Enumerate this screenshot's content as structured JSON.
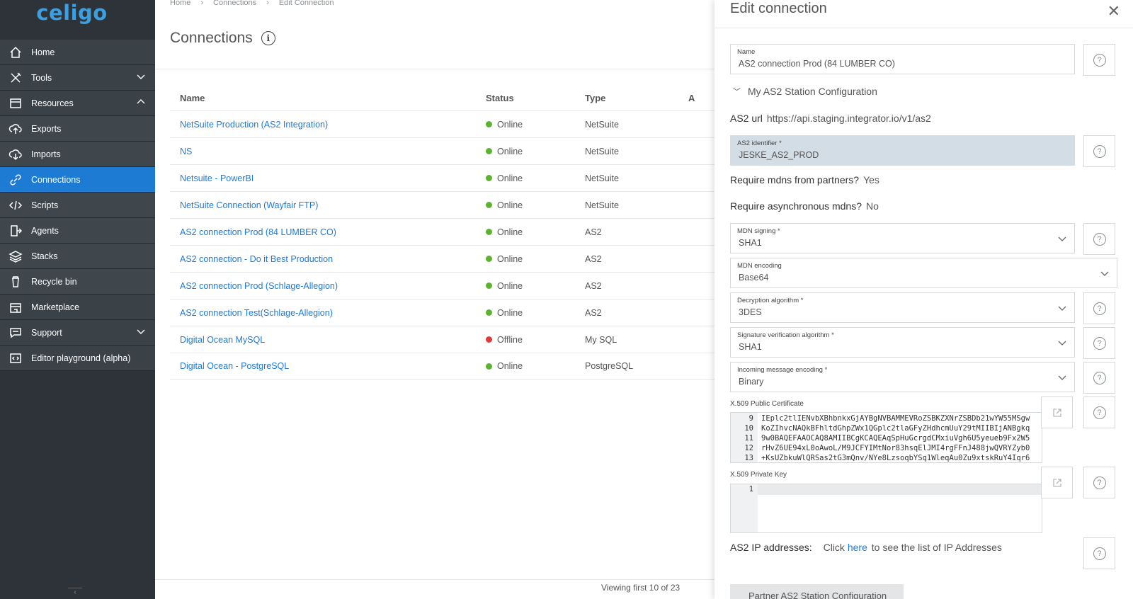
{
  "app": {
    "logo": "celigo"
  },
  "sidebar": {
    "items": [
      {
        "label": "Home",
        "icon": "home-icon"
      },
      {
        "label": "Tools",
        "icon": "tools-icon",
        "chevron": "down"
      },
      {
        "label": "Resources",
        "icon": "resources-icon",
        "chevron": "up"
      },
      {
        "label": "Exports",
        "icon": "upload-icon",
        "sub": true
      },
      {
        "label": "Imports",
        "icon": "download-icon",
        "sub": true
      },
      {
        "label": "Connections",
        "icon": "link-icon",
        "sub": true,
        "active": true
      },
      {
        "label": "Scripts",
        "icon": "code-icon",
        "sub": true
      },
      {
        "label": "Agents",
        "icon": "agent-icon",
        "sub": true
      },
      {
        "label": "Stacks",
        "icon": "stack-icon",
        "sub": true
      },
      {
        "label": "Recycle bin",
        "icon": "recycle-icon",
        "sub": true
      },
      {
        "label": "Marketplace",
        "icon": "store-icon"
      },
      {
        "label": "Support",
        "icon": "chat-icon",
        "chevron": "down"
      },
      {
        "label": "Editor playground (alpha)",
        "icon": "editor-icon"
      }
    ]
  },
  "breadcrumb": [
    "Home",
    "Connections",
    "Edit Connection"
  ],
  "page": {
    "title": "Connections"
  },
  "table": {
    "headers": [
      "Name",
      "Status",
      "Type",
      "A"
    ],
    "rows": [
      {
        "name": "NetSuite Production (AS2 Integration)",
        "status": "Online",
        "type": "NetSuite"
      },
      {
        "name": "NS",
        "status": "Online",
        "type": "NetSuite"
      },
      {
        "name": "Netsuite - PowerBI",
        "status": "Online",
        "type": "NetSuite"
      },
      {
        "name": "NetSuite Connection (Wayfair FTP)",
        "status": "Online",
        "type": "NetSuite"
      },
      {
        "name": "AS2 connection Prod (84 LUMBER CO)",
        "status": "Online",
        "type": "AS2"
      },
      {
        "name": "AS2 connection - Do it Best Production",
        "status": "Online",
        "type": "AS2"
      },
      {
        "name": "AS2 connection Prod (Schlage-Allegion)",
        "status": "Online",
        "type": "AS2"
      },
      {
        "name": "AS2 connection Test(Schlage-Allegion)",
        "status": "Online",
        "type": "AS2"
      },
      {
        "name": "Digital Ocean MySQL",
        "status": "Offline",
        "type": "My SQL"
      },
      {
        "name": "Digital Ocean - PostgreSQL",
        "status": "Online",
        "type": "PostgreSQL"
      }
    ],
    "pager": "Viewing first 10 of 23"
  },
  "colors": {
    "online": "#5cb331",
    "offline": "#e03a3a",
    "accent": "#1d7bd4",
    "sidebar": "#2d3338"
  },
  "panel": {
    "title": "Edit connection",
    "name_label": "Name",
    "name_value": "AS2 connection Prod (84 LUMBER CO)",
    "my_station_toggle": "My AS2 Station Configuration",
    "as2_url_label": "AS2 url",
    "as2_url_value": "https://api.staging.integrator.io/v1/as2",
    "as2_identifier_label": "AS2 identifier *",
    "as2_identifier_value": "JESKE_AS2_PROD",
    "require_mdns_label": "Require mdns from partners?",
    "require_mdns_value": "Yes",
    "require_async_label": "Require asynchronous mdns?",
    "require_async_value": "No",
    "mdn_signing_label": "MDN signing *",
    "mdn_signing_value": "SHA1",
    "mdn_encoding_label": "MDN encoding",
    "mdn_encoding_value": "Base64",
    "decryption_label": "Decryption algorithm *",
    "decryption_value": "3DES",
    "sig_verif_label": "Signature verification algorithm *",
    "sig_verif_value": "SHA1",
    "incoming_enc_label": "Incoming message encoding *",
    "incoming_enc_value": "Binary",
    "public_cert_label": "X.509 Public Certificate",
    "public_cert_lines": [
      {
        "n": "9",
        "t": "IEplc2tlIENvbXBhbnkxGjAYBgNVBAMMEVRoZSBKZXNrZSBDb21wYW55MSgw"
      },
      {
        "n": "10",
        "t": "KoZIhvcNAQkBFhltdGhpZWx1QGplc2tlaGFyZHdhcmUuY29tMIIBIjANBgkq"
      },
      {
        "n": "11",
        "t": "9w0BAQEFAAOCAQ8AMIIBCgKCAQEAqSpHuGcrgdCMxiuVgh6U5yeueb9Fx2W5"
      },
      {
        "n": "12",
        "t": "rHvZ6UE94xL0oAwoL/M9JCFYIMtNor83hsqElJMI4rgFFnJ488jwQVRYZyb0"
      },
      {
        "n": "13",
        "t": "+KsUZbkuWlQRSas2tG3mQnv/NYe8LzsoqbYSq1WleqAu0Zu9xtskRuY4Iqr6"
      }
    ],
    "private_key_label": "X.509 Private Key",
    "private_key_lines": [
      {
        "n": "1",
        "t": ""
      }
    ],
    "ip_label": "AS2 IP addresses:",
    "ip_text_before": "Click",
    "ip_link": "here",
    "ip_text_after": "to see the list of IP Addresses",
    "partner_toggle": "Partner AS2 Station Configuration"
  }
}
